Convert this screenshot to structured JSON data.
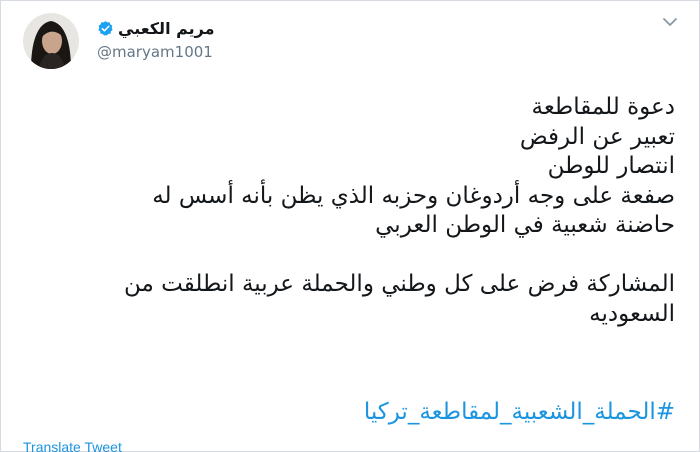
{
  "author": {
    "display_name": "مريم الكعبي",
    "handle": "@maryam1001",
    "verified": true
  },
  "tweet": {
    "lines_block1": [
      "دعوة للمقاطعة",
      "تعبير عن الرفض",
      "انتصار للوطن",
      "صفعة على وجه أردوغان وحزبه الذي يظن بأنه أسس له",
      "حاضنة شعبية في الوطن العربي"
    ],
    "lines_block2": [
      "المشاركة فرض على كل وطني والحملة عربية انطلقت من",
      "السعوديه"
    ],
    "hashtag": "#الحملة_الشعبية_لمقاطعة_تركيا"
  },
  "actions": {
    "translate_label": "Translate Tweet"
  },
  "colors": {
    "link": "#1b95e0",
    "text": "#14171a",
    "secondary": "#657786"
  }
}
